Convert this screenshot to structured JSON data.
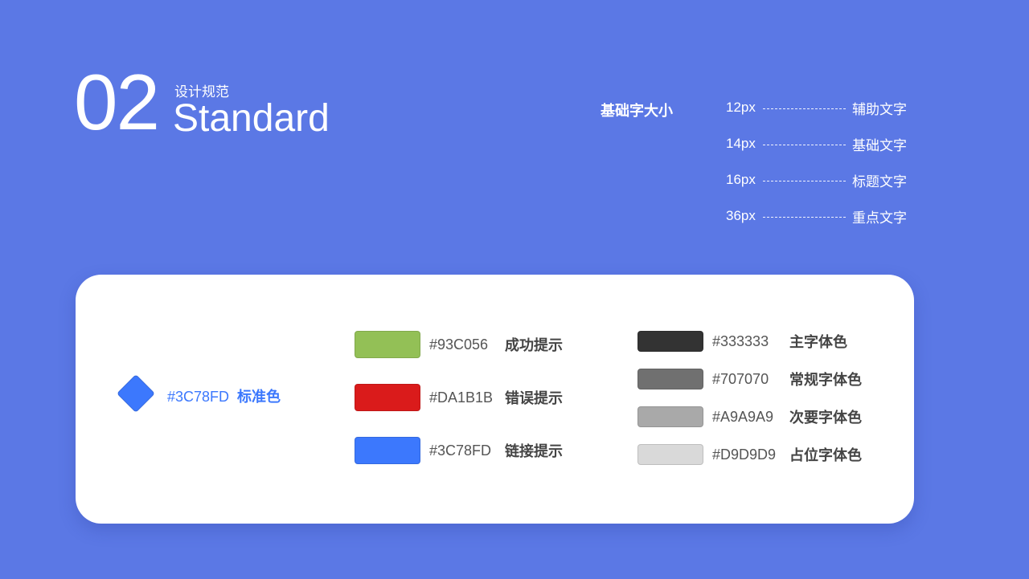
{
  "header": {
    "number": "02",
    "subtitle": "设计规范",
    "title": "Standard"
  },
  "font_sizes": {
    "heading": "基础字大小",
    "items": [
      {
        "size": "12px",
        "label": "辅助文字"
      },
      {
        "size": "14px",
        "label": "基础文字"
      },
      {
        "size": "16px",
        "label": "标题文字"
      },
      {
        "size": "36px",
        "label": "重点文字"
      }
    ]
  },
  "colors": {
    "standard": {
      "hex": "#3C78FD",
      "label": "标准色",
      "color": "#3C78FD"
    },
    "status": [
      {
        "hex": "#93C056",
        "label": "成功提示",
        "color": "#93C056"
      },
      {
        "hex": "#DA1B1B",
        "label": "错误提示",
        "color": "#DA1B1B"
      },
      {
        "hex": "#3C78FD",
        "label": "链接提示",
        "color": "#3C78FD"
      }
    ],
    "text": [
      {
        "hex": "#333333",
        "label": "主字体色",
        "color": "#333333"
      },
      {
        "hex": "#707070",
        "label": "常规字体色",
        "color": "#707070"
      },
      {
        "hex": "#A9A9A9",
        "label": "次要字体色",
        "color": "#A9A9A9"
      },
      {
        "hex": "#D9D9D9",
        "label": "占位字体色",
        "color": "#D9D9D9"
      }
    ]
  },
  "theme": {
    "background": "#5B78E5",
    "card": "#FFFFFF"
  }
}
